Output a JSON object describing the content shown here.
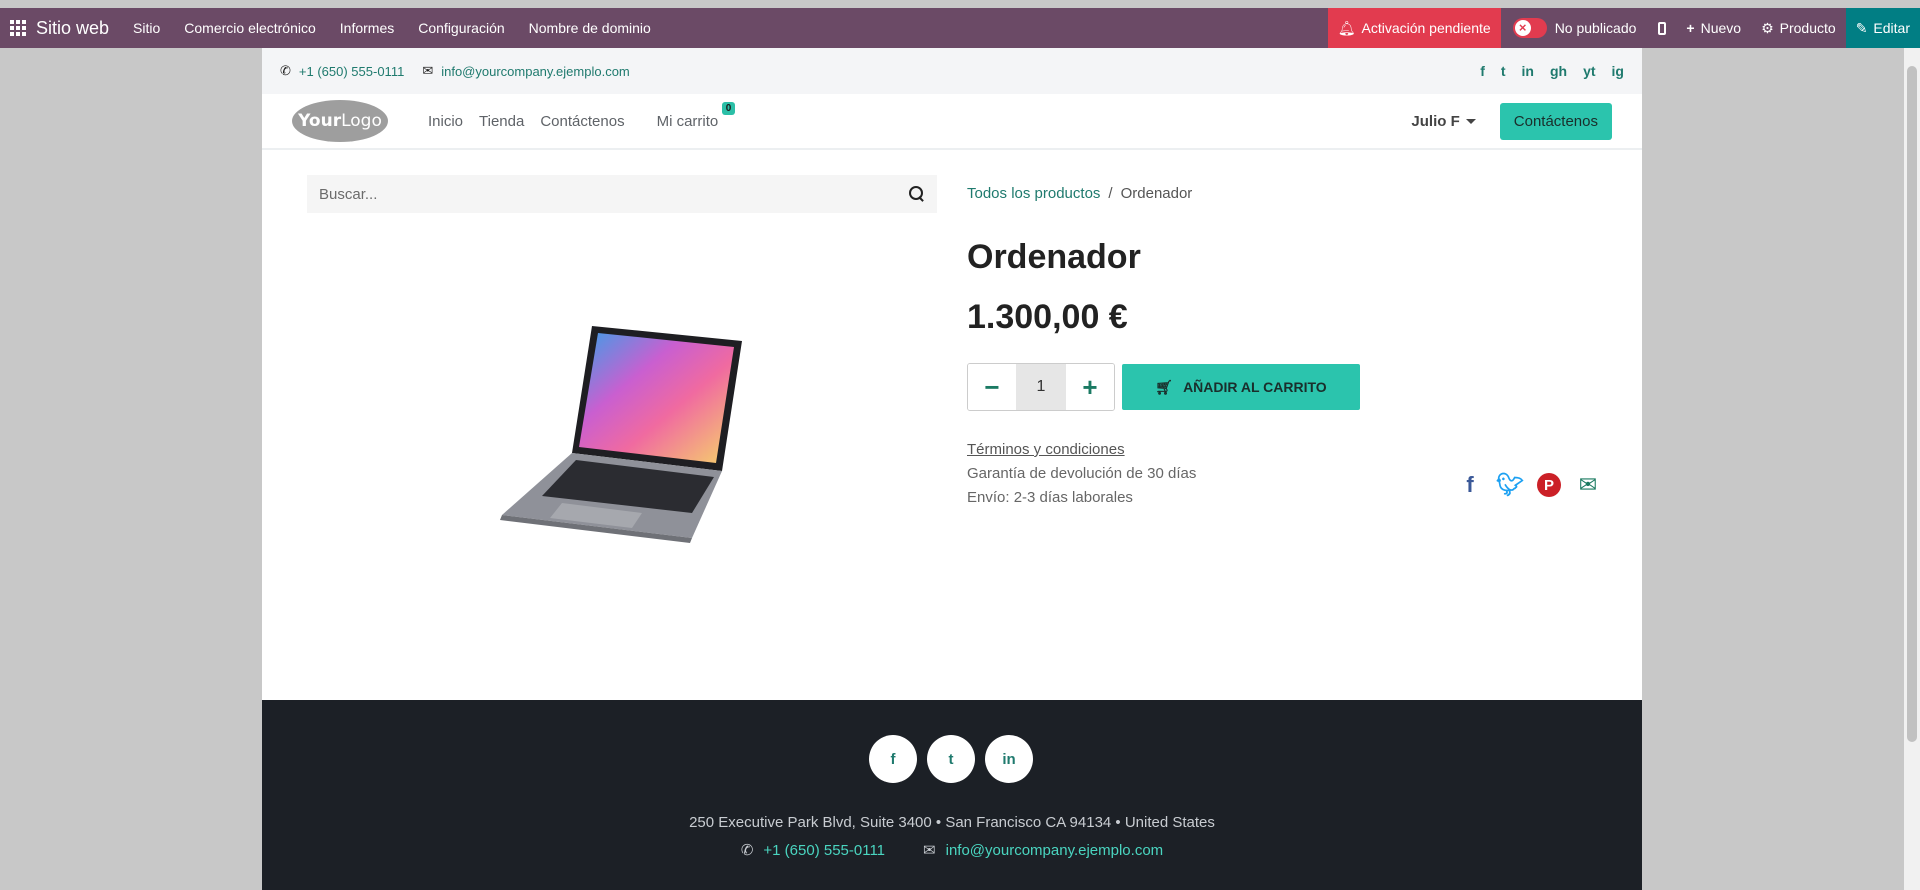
{
  "topbar": {
    "brand": "Sitio web",
    "menu": [
      "Sitio",
      "Comercio electrónico",
      "Informes",
      "Configuración",
      "Nombre de dominio"
    ],
    "pending": "Activación pendiente",
    "unpublished": "No publicado",
    "new": "Nuevo",
    "product": "Producto",
    "edit": "Editar"
  },
  "contact": {
    "phone": "+1 (650) 555-0111",
    "email": "info@yourcompany.ejemplo.com",
    "socials": [
      "f",
      "t",
      "in",
      "gh",
      "yt",
      "ig"
    ]
  },
  "navbar": {
    "logo_bold": "Your",
    "logo_rest": "Logo",
    "links": [
      "Inicio",
      "Tienda",
      "Contáctenos"
    ],
    "cart_label": "Mi carrito",
    "cart_count": "0",
    "user": "Julio F",
    "cta": "Contáctenos"
  },
  "search": {
    "placeholder": "Buscar..."
  },
  "breadcrumb": {
    "parent": "Todos los productos",
    "separator": "/",
    "current": "Ordenador"
  },
  "product": {
    "name": "Ordenador",
    "price": "1.300,00 €",
    "quantity": "1",
    "add_to_cart": "AÑADIR AL CARRITO",
    "terms": "Términos y condiciones",
    "warranty": "Garantía de devolución de 30 días",
    "shipping": "Envío: 2-3 días laborales"
  },
  "footer": {
    "address": "250 Executive Park Blvd, Suite 3400 • San Francisco CA 94134 • United States",
    "phone": "+1 (650) 555-0111",
    "email": "info@yourcompany.ejemplo.com"
  },
  "colors": {
    "admin_bar": "#6b4a66",
    "accent": "#2bc4ad",
    "danger": "#e23b4f",
    "footer": "#1c2026"
  }
}
